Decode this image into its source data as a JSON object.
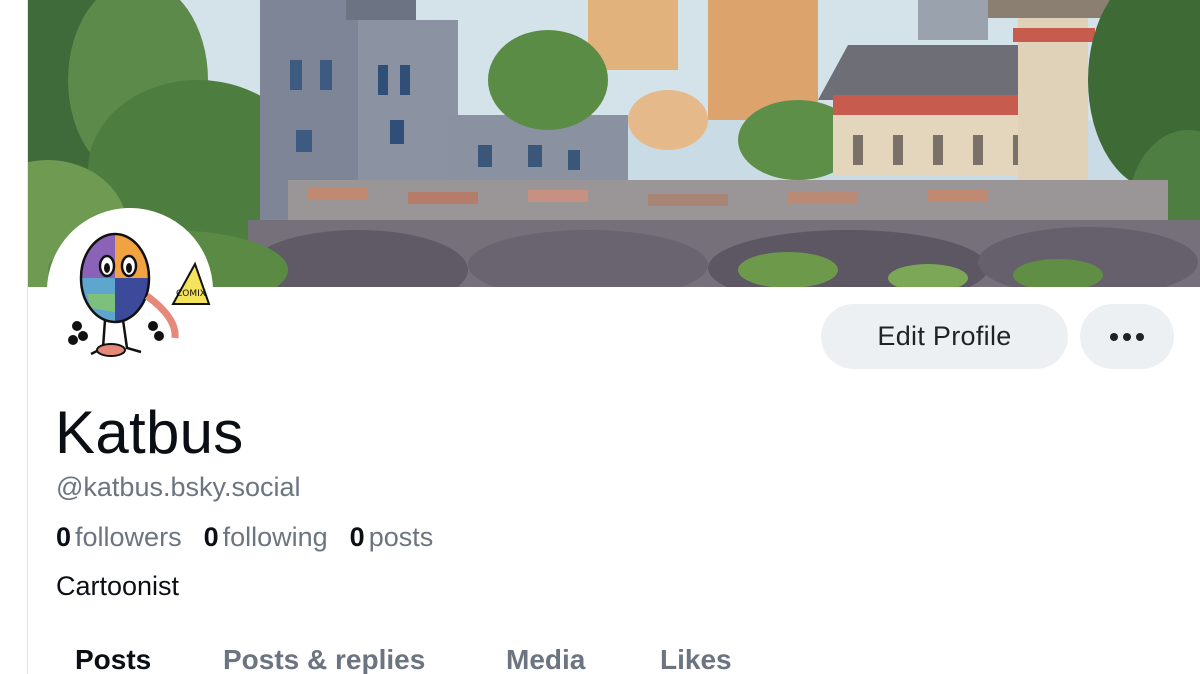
{
  "profile": {
    "display_name": "Katbus",
    "handle": "@katbus.bsky.social",
    "bio": "Cartoonist",
    "avatar_text": "COMIX"
  },
  "stats": [
    {
      "count": "0",
      "label": "followers"
    },
    {
      "count": "0",
      "label": "following"
    },
    {
      "count": "0",
      "label": "posts"
    }
  ],
  "actions": {
    "edit_profile_label": "Edit Profile",
    "more_icon": "ellipsis-icon"
  },
  "tabs": [
    {
      "label": "Posts",
      "active": true
    },
    {
      "label": "Posts & replies",
      "active": false
    },
    {
      "label": "Media",
      "active": false
    },
    {
      "label": "Likes",
      "active": false
    }
  ],
  "colors": {
    "button_bg": "#edf0f3",
    "text_primary": "#0b0f14",
    "text_secondary": "#6b7480"
  }
}
